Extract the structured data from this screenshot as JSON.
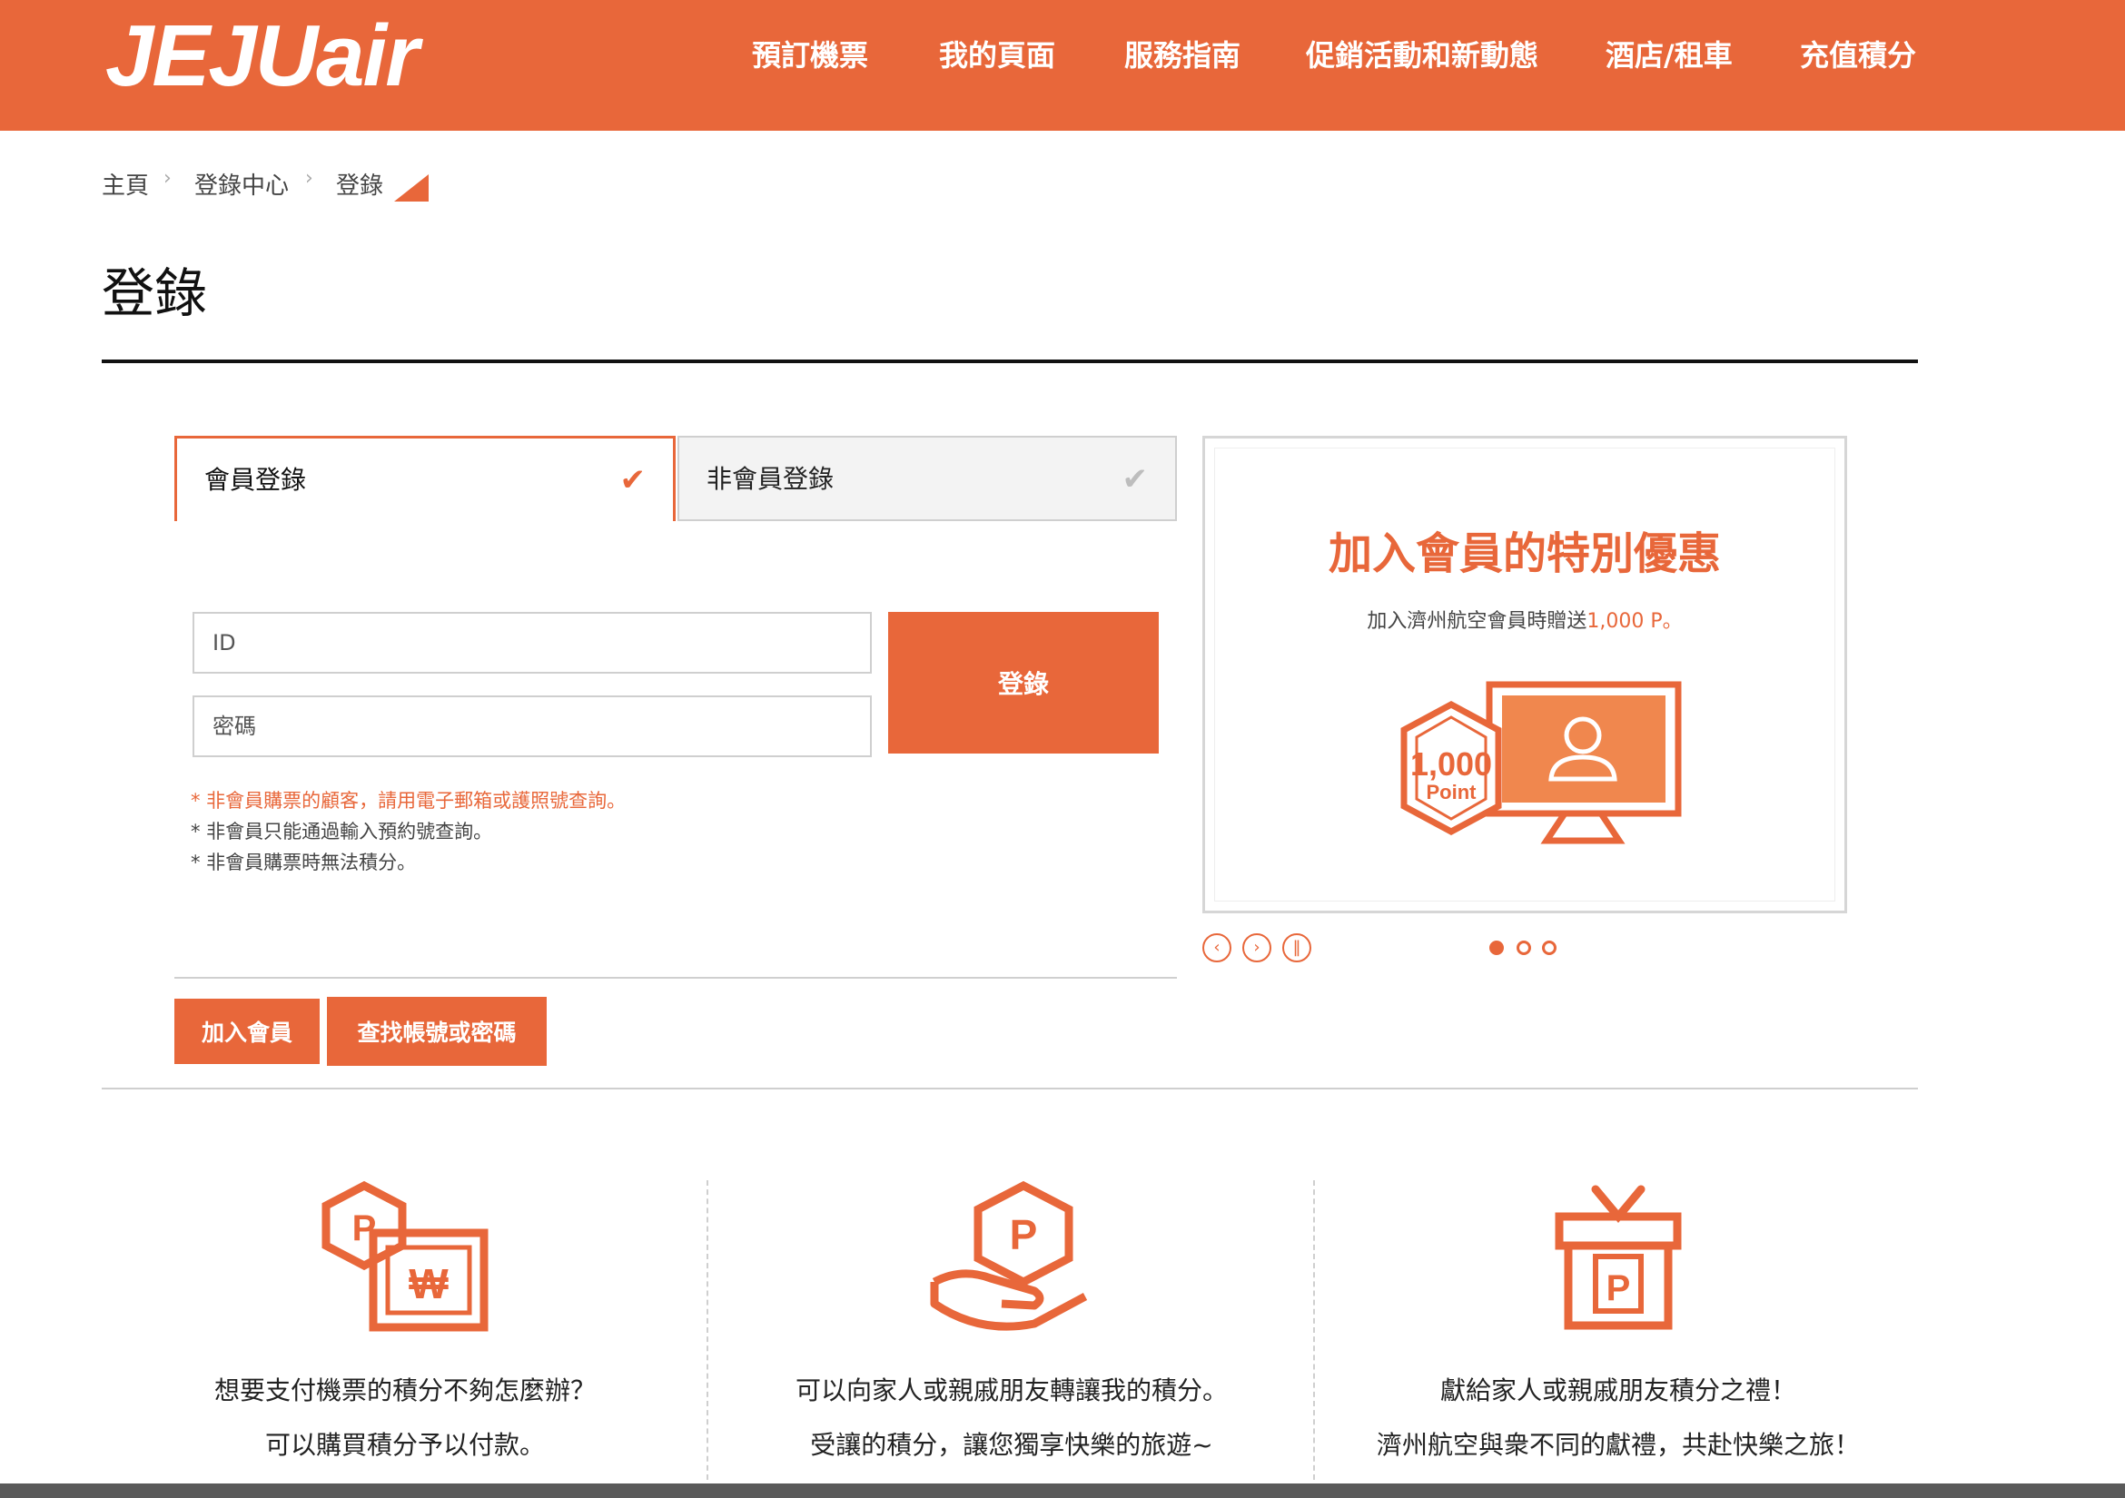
{
  "header": {
    "logo": "JEJUair",
    "nav": [
      "預訂機票",
      "我的頁面",
      "服務指南",
      "促銷活動和新動態",
      "酒店/租車",
      "充值積分"
    ]
  },
  "breadcrumb": [
    "主頁",
    "登錄中心",
    "登錄"
  ],
  "page_title": "登錄",
  "tabs": {
    "member": "會員登錄",
    "nonmember": "非會員登錄"
  },
  "form": {
    "id_placeholder": "ID",
    "password_placeholder": "密碼",
    "login_label": "登錄"
  },
  "notes": [
    "* 非會員購票的顧客，請用電子郵箱或護照號查詢。",
    "* 非會員只能通過輸入預約號查詢。",
    "* 非會員購票時無法積分。"
  ],
  "buttons": {
    "join": "加入會員",
    "find": "查找帳號或密碼"
  },
  "promo": {
    "title": "加入會員的特別優惠",
    "subtitle_prefix": "加入濟州航空會員時贈送",
    "subtitle_highlight": "1,000 P",
    "subtitle_suffix": "。",
    "badge_value": "1,000",
    "badge_unit": "Point",
    "active_slide": 1,
    "slide_count": 3
  },
  "features": [
    {
      "icon": "points-to-cash-icon",
      "line1": "想要支付機票的積分不夠怎麼辦？",
      "line2": "可以購買積分予以付款。"
    },
    {
      "icon": "points-transfer-icon",
      "line1": "可以向家人或親戚朋友轉讓我的積分。",
      "line2": "受讓的積分，讓您獨享快樂的旅遊~"
    },
    {
      "icon": "points-gift-icon",
      "line1": "獻給家人或親戚朋友積分之禮！",
      "line2": "濟州航空與衆不同的獻禮，共赴快樂之旅！"
    }
  ],
  "colors": {
    "brand": "#e8673a"
  }
}
